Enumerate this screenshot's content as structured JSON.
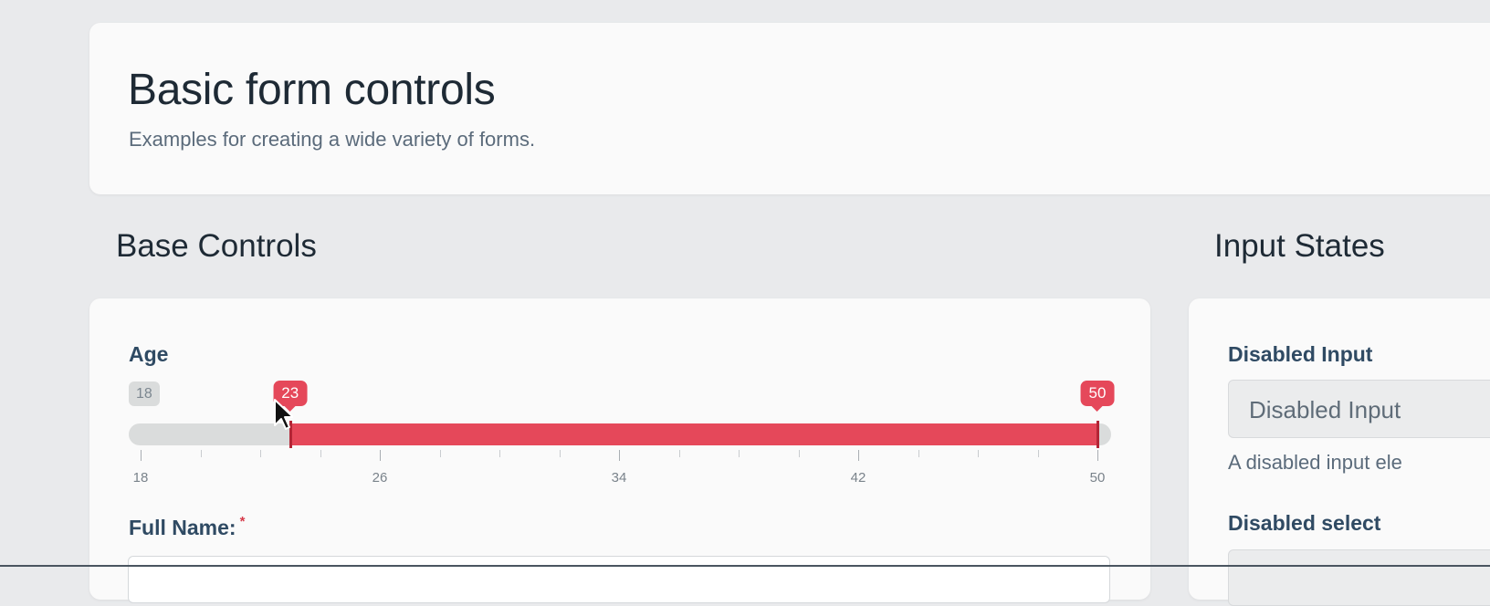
{
  "header": {
    "title": "Basic form controls",
    "subtitle": "Examples for creating a wide variety of forms."
  },
  "sections": {
    "base_controls": "Base Controls",
    "input_states": "Input States"
  },
  "age": {
    "label": "Age",
    "min": 18,
    "max": 50,
    "min_label": "18",
    "low_value": 23,
    "high_value": 50,
    "low_label": "23",
    "high_label": "50",
    "major_ticks": [
      "18",
      "26",
      "34",
      "42",
      "50"
    ]
  },
  "full_name": {
    "label": "Full Name:",
    "required_mark": "*",
    "value": ""
  },
  "states": {
    "disabled_input_label": "Disabled Input",
    "disabled_input_value": "Disabled Input",
    "disabled_input_help": "A disabled input ele",
    "disabled_select_label": "Disabled select"
  },
  "colors": {
    "accent": "#e5485a",
    "track": "#dadcdc",
    "label": "#2f4a63"
  },
  "icons": {
    "cursor": "mouse-pointer-icon"
  }
}
